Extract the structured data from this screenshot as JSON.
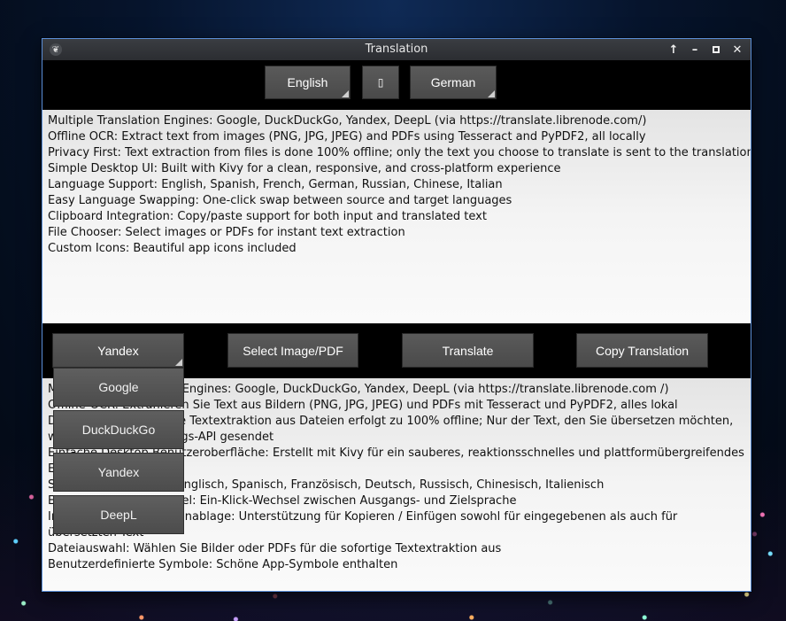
{
  "window": {
    "title": "Translation",
    "controls": {
      "keep_above_glyph": "↑",
      "minimize_glyph": "–",
      "close_glyph": "✕"
    }
  },
  "languages": {
    "source": "English",
    "swap_glyph": "▯",
    "target": "German"
  },
  "input_lines": [
    "Multiple Translation Engines: Google, DuckDuckGo, Yandex, DeepL (via https://translate.librenode.com/)",
    "Offline OCR: Extract text from images (PNG, JPG, JPEG) and PDFs using Tesseract and PyPDF2, all locally",
    "Privacy First: Text extraction from files is done 100% offline; only the text you choose to translate is sent to the translation API",
    "Simple Desktop UI: Built with Kivy for a clean, responsive, and cross-platform experience",
    "Language Support: English, Spanish, French, German, Russian, Chinese, Italian",
    "Easy Language Swapping: One-click swap between source and target languages",
    "Clipboard Integration: Copy/paste support for both input and translated text",
    "File Chooser: Select images or PDFs for instant text extraction",
    "Custom Icons: Beautiful app icons included"
  ],
  "actions": {
    "engine": "Yandex",
    "select_file": "Select Image/PDF",
    "translate": "Translate",
    "copy": "Copy Translation"
  },
  "engine_options": [
    "Google",
    "DuckDuckGo",
    "Yandex",
    "DeepL"
  ],
  "output_lines": [
    "Mehrere Übersetzungs-Engines: Google, DuckDuckGo, Yandex, DeepL (via https://translate.librenode.com /)",
    "Offline-OCR: Extrahieren Sie Text aus Bildern (PNG, JPG, JPEG) und PDFs mit Tesseract und PyPDF2, alles lokal",
    "Datenschutz zuerst: Die Textextraktion aus Dateien erfolgt zu 100% offline; Nur der Text, den Sie übersetzen möchten, wird an die Übersetzungs-API gesendet",
    "Einfache Desktop-Benutzeroberfläche: Erstellt mit Kivy für ein sauberes, reaktionsschnelles und plattformübergreifendes Erlebnis",
    "Sprachunterstützung: Englisch, Spanisch, Französisch, Deutsch, Russisch, Chinesisch, Italienisch",
    "Einfacher Sprachwechsel: Ein-Klick-Wechsel zwischen Ausgangs- und Zielsprache",
    "Integration der Zwischenablage: Unterstützung für Kopieren / Einfügen sowohl für eingegebenen als auch für übersetzten Text",
    "Dateiauswahl: Wählen Sie Bilder oder PDFs für die sofortige Textextraktion aus",
    "Benutzerdefinierte Symbole: Schöne App-Symbole enthalten"
  ]
}
